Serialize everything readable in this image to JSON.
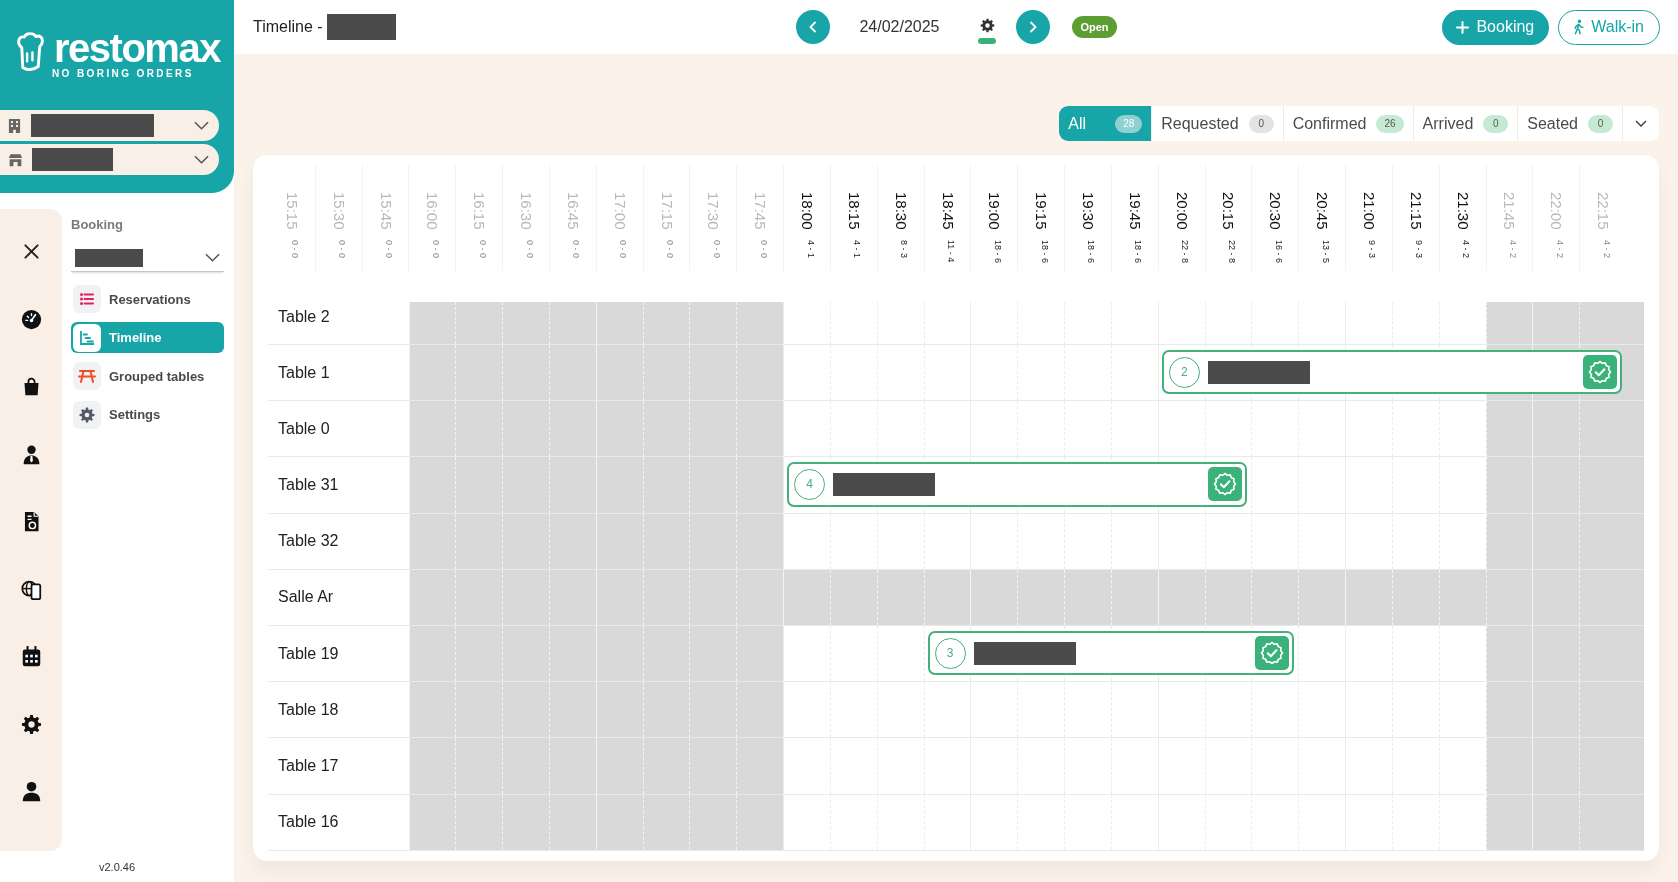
{
  "sidebar": {
    "brand": {
      "name": "restomax",
      "tagline": "NO BORING ORDERS"
    },
    "booking_nav": {
      "title": "Booking",
      "items": [
        {
          "label": "Reservations",
          "selected": false
        },
        {
          "label": "Timeline",
          "selected": true
        },
        {
          "label": "Grouped tables",
          "selected": false
        },
        {
          "label": "Settings",
          "selected": false
        }
      ]
    },
    "version": "v2.0.46"
  },
  "top_bar": {
    "title": "Timeline -",
    "date": "24/02/2025",
    "status": "Open",
    "actions": [
      {
        "label": "Booking",
        "kind": "primary"
      },
      {
        "label": "Walk-in",
        "kind": "secondary"
      }
    ]
  },
  "filters": [
    {
      "label": "All",
      "count": "28",
      "selected": true,
      "color": "#8fd0d2"
    },
    {
      "label": "Requested",
      "count": "0",
      "selected": false,
      "color": "#e3e3e3"
    },
    {
      "label": "Confirmed",
      "count": "26",
      "selected": false,
      "color": "#c6e9d4"
    },
    {
      "label": "Arrived",
      "count": "0",
      "selected": false,
      "color": "#c6e9d4"
    },
    {
      "label": "Seated",
      "count": "0",
      "selected": false,
      "color": "#c6e9d4"
    }
  ],
  "timeline": {
    "slots": [
      {
        "time": "15:15",
        "counts": "0 - 0",
        "available": false
      },
      {
        "time": "15:30",
        "counts": "0 - 0",
        "available": false
      },
      {
        "time": "15:45",
        "counts": "0 - 0",
        "available": false
      },
      {
        "time": "16:00",
        "counts": "0 - 0",
        "available": false
      },
      {
        "time": "16:15",
        "counts": "0 - 0",
        "available": false
      },
      {
        "time": "16:30",
        "counts": "0 - 0",
        "available": false
      },
      {
        "time": "16:45",
        "counts": "0 - 0",
        "available": false
      },
      {
        "time": "17:00",
        "counts": "0 - 0",
        "available": false
      },
      {
        "time": "17:15",
        "counts": "0 - 0",
        "available": false
      },
      {
        "time": "17:30",
        "counts": "0 - 0",
        "available": false
      },
      {
        "time": "17:45",
        "counts": "0 - 0",
        "available": false
      },
      {
        "time": "18:00",
        "counts": "4 - 1",
        "available": true
      },
      {
        "time": "18:15",
        "counts": "4 - 1",
        "available": true
      },
      {
        "time": "18:30",
        "counts": "8 - 3",
        "available": true
      },
      {
        "time": "18:45",
        "counts": "11 - 4",
        "available": true
      },
      {
        "time": "19:00",
        "counts": "18 - 6",
        "available": true
      },
      {
        "time": "19:15",
        "counts": "18 - 6",
        "available": true
      },
      {
        "time": "19:30",
        "counts": "18 - 6",
        "available": true
      },
      {
        "time": "19:45",
        "counts": "18 - 6",
        "available": true
      },
      {
        "time": "20:00",
        "counts": "22 - 8",
        "available": true
      },
      {
        "time": "20:15",
        "counts": "22 - 8",
        "available": true
      },
      {
        "time": "20:30",
        "counts": "16 - 6",
        "available": true
      },
      {
        "time": "20:45",
        "counts": "13 - 5",
        "available": true
      },
      {
        "time": "21:00",
        "counts": "9 - 3",
        "available": true
      },
      {
        "time": "21:15",
        "counts": "9 - 3",
        "available": true
      },
      {
        "time": "21:30",
        "counts": "4 - 2",
        "available": true
      },
      {
        "time": "21:45",
        "counts": "4 - 2",
        "available": false
      },
      {
        "time": "22:00",
        "counts": "4 - 2",
        "available": false
      },
      {
        "time": "22:15",
        "counts": "4 - 2",
        "available": false
      }
    ],
    "rows": [
      {
        "name": "Table 2",
        "available": true
      },
      {
        "name": "Table 1",
        "available": true,
        "bookings": [
          {
            "guests": "2",
            "kind": "confirmed"
          }
        ]
      },
      {
        "name": "Table 0",
        "available": true
      },
      {
        "name": "Table 31",
        "available": true,
        "bookings": [
          {
            "guests": "4",
            "kind": "confirmed"
          }
        ]
      },
      {
        "name": "Table 32",
        "available": true
      },
      {
        "name": "Salle Ar",
        "available": false
      },
      {
        "name": "Table 19",
        "available": true,
        "bookings": [
          {
            "guests": "3",
            "kind": "confirmed"
          }
        ]
      },
      {
        "name": "Table 18",
        "available": true
      },
      {
        "name": "Table 17",
        "available": true
      },
      {
        "name": "Table 16",
        "available": true
      }
    ]
  }
}
